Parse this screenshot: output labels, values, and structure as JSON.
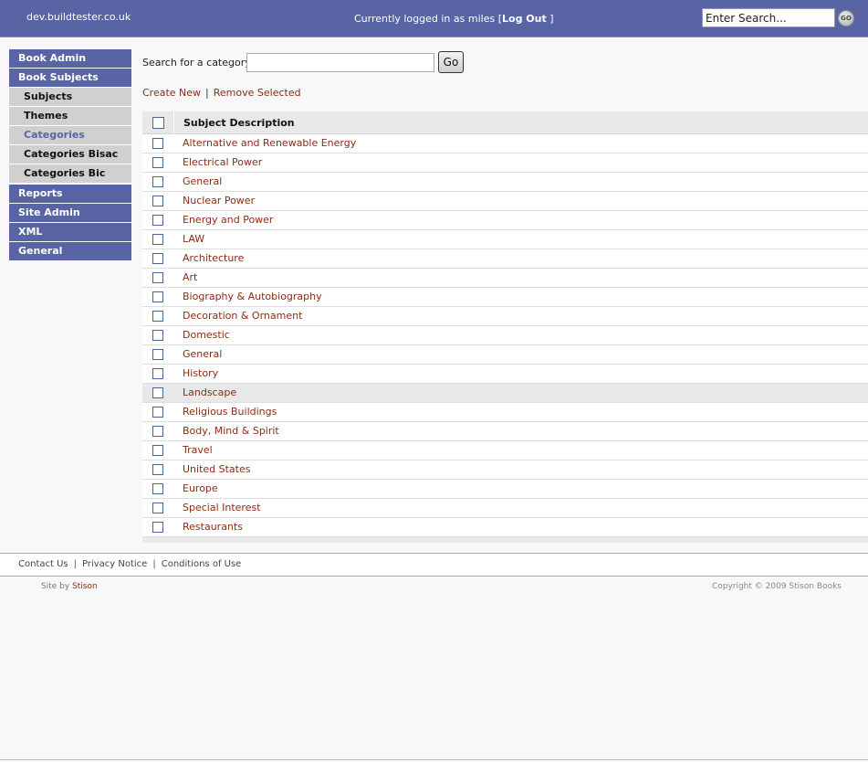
{
  "header": {
    "site_name": "dev.buildtester.co.uk",
    "login_prefix": "Currently logged in as miles",
    "bracket_open": "[",
    "logout_label": "Log Out",
    "bracket_close": "]",
    "search_value": "Enter Search...",
    "go_label": "GO"
  },
  "sidebar": {
    "book_admin": "Book Admin",
    "book_subjects": "Book Subjects",
    "sub_items": [
      {
        "label": "Subjects"
      },
      {
        "label": "Themes"
      },
      {
        "label": "Categories"
      },
      {
        "label": "Categories Bisac"
      },
      {
        "label": "Categories Bic"
      }
    ],
    "reports": "Reports",
    "site_admin": "Site Admin",
    "xml": "XML",
    "general": "General"
  },
  "search": {
    "label": "Search for a category",
    "value": "",
    "go_label": "Go"
  },
  "actions": {
    "create_new": "Create New",
    "separator": "|",
    "remove_selected": "Remove Selected"
  },
  "table": {
    "column_header": "Subject Description",
    "rows": [
      "Alternative and Renewable Energy",
      "Electrical Power",
      "General",
      "Nuclear Power",
      "Energy and Power",
      "LAW",
      "Architecture",
      "Art",
      "Biography & Autobiography",
      "Decoration & Ornament",
      "Domestic",
      "General",
      "History",
      "Landscape",
      "Religious Buildings",
      "Body, Mind & Spirit",
      "Travel",
      "United States",
      "Europe",
      "Special Interest",
      "Restaurants"
    ]
  },
  "footer": {
    "contact": "Contact Us",
    "privacy": "Privacy Notice",
    "conditions": "Conditions of Use",
    "separator": "|",
    "site_by_prefix": "Site by",
    "site_by_link": "Stison",
    "copyright": "Copyright © 2009 Stison Books"
  }
}
